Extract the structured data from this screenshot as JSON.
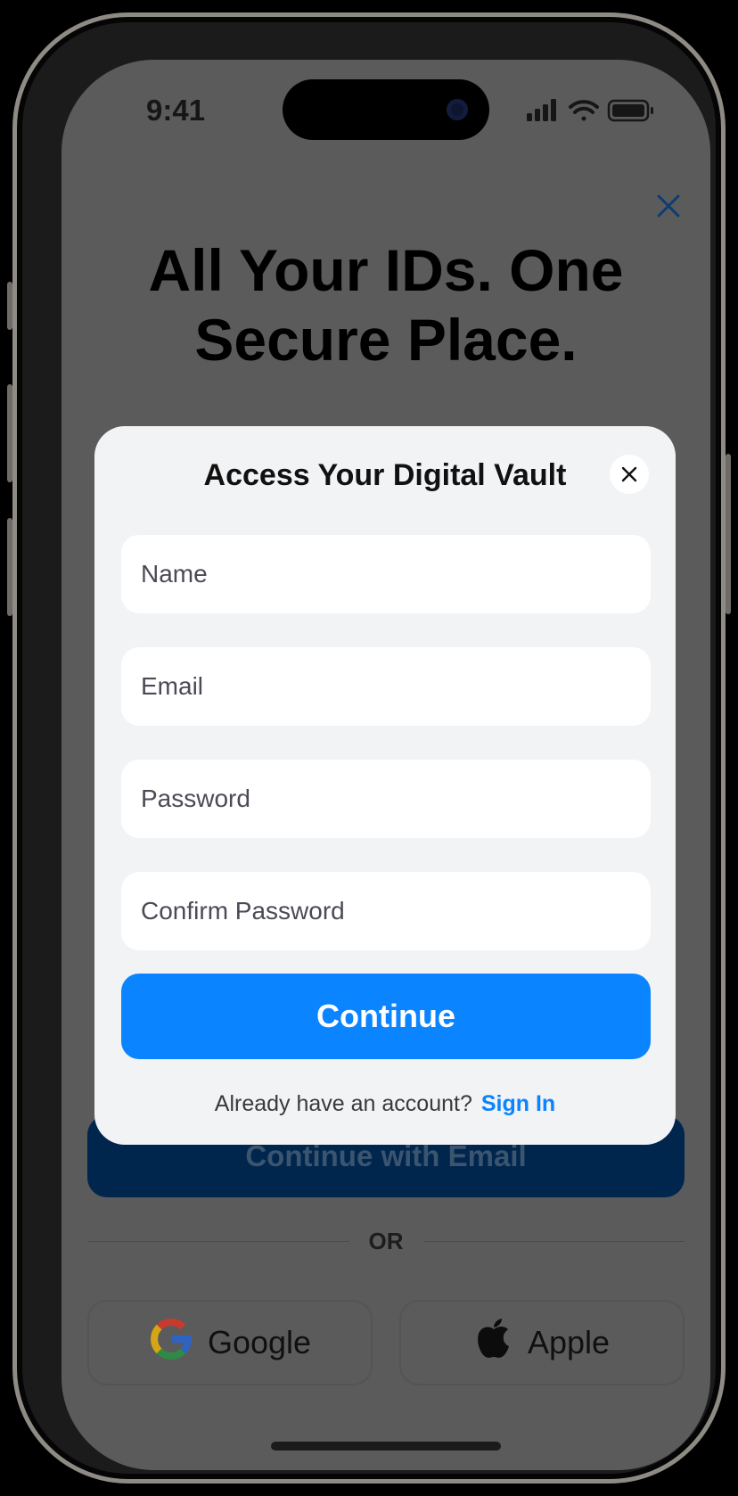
{
  "status_bar": {
    "time": "9:41",
    "icons": [
      "signal-icon",
      "wifi-icon",
      "battery-icon"
    ]
  },
  "background": {
    "close_icon": "close-icon",
    "headline_line1": "All Your IDs. One",
    "headline_line2": "Secure Place.",
    "email_button_label": "Continue with Email",
    "or_label": "OR",
    "google_label": "Google",
    "apple_label": "Apple"
  },
  "modal": {
    "title": "Access Your Digital Vault",
    "close_icon": "close-icon",
    "fields": {
      "name_placeholder": "Name",
      "email_placeholder": "Email",
      "password_placeholder": "Password",
      "confirm_password_placeholder": "Confirm Password"
    },
    "continue_label": "Continue",
    "signin_prompt": "Already have an account?",
    "signin_link": "Sign In"
  },
  "colors": {
    "accent": "#0a84ff",
    "overlay": "#5b5b5b",
    "modal_bg": "#f2f3f5",
    "email_button": "#00264e"
  }
}
